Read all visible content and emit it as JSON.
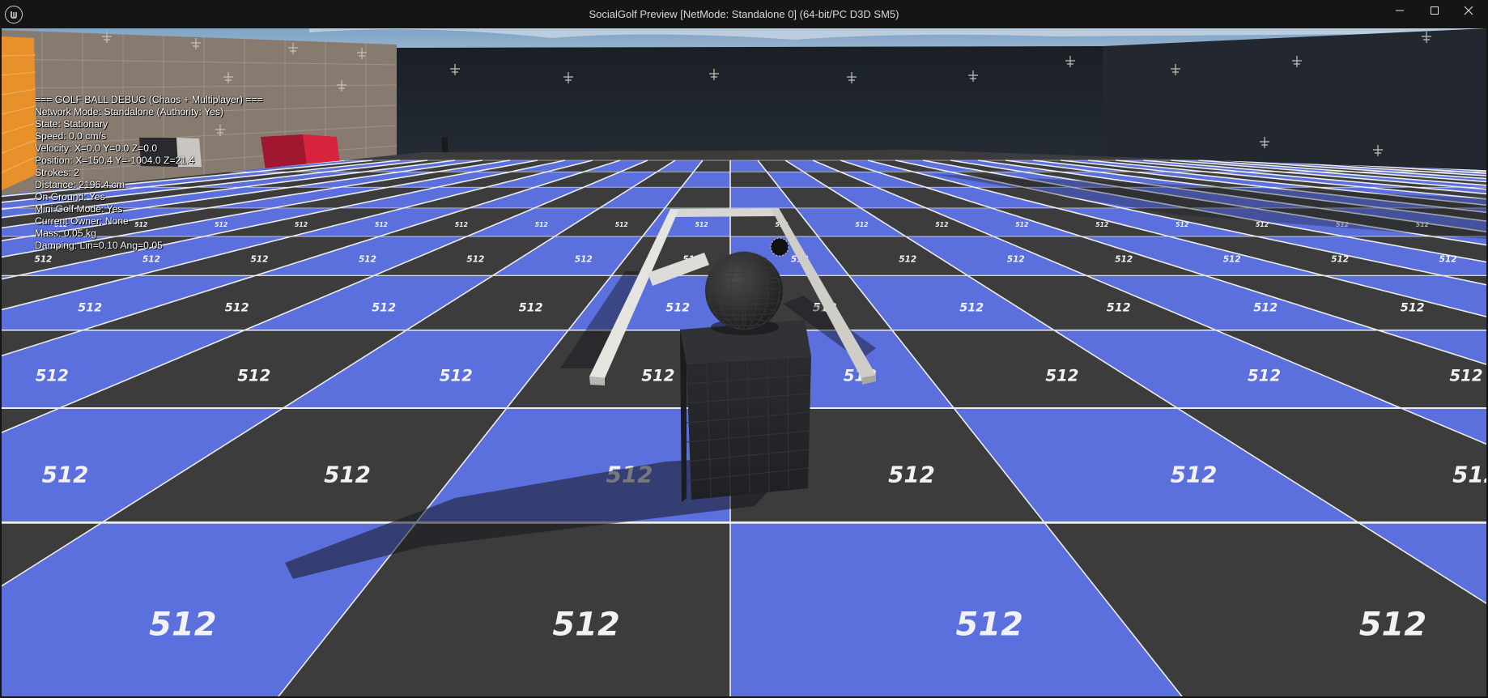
{
  "window": {
    "title": "SocialGolf Preview [NetMode: Standalone 0]  (64-bit/PC D3D SM5)",
    "app_icon": "unreal-engine-logo-icon",
    "controls": {
      "minimize_icon": "minimize-icon",
      "maximize_icon": "maximize-icon",
      "close_icon": "close-icon"
    }
  },
  "debug_overlay": {
    "header": "=== GOLF BALL DEBUG (Chaos + Multiplayer) ===",
    "lines": [
      "Network Mode: Standalone (Authority: Yes)",
      "State: Stationary",
      "Speed: 0.0 cm/s",
      "Velocity: X=0.0 Y=0.0 Z=0.0",
      "Position: X=150.4 Y=-1004.0 Z=21.4",
      "Strokes: 2",
      "Distance: 2196.4 cm",
      "On Ground: Yes",
      "Mini Golf Mode: Yes",
      "Current Owner: None",
      "Mass: 0.05 kg",
      "Damping: Lin=0.10 Ang=0.05"
    ]
  },
  "scene": {
    "floor_tile_label": "512",
    "colors": {
      "tile_blue": "#5b6fdd",
      "tile_dark": "#3c3c3c",
      "grid_line": "#e9e9e9",
      "wall_dark": "#1c2128",
      "wall_beige": "#8a7e72",
      "sky": "#8fb2cf"
    }
  }
}
